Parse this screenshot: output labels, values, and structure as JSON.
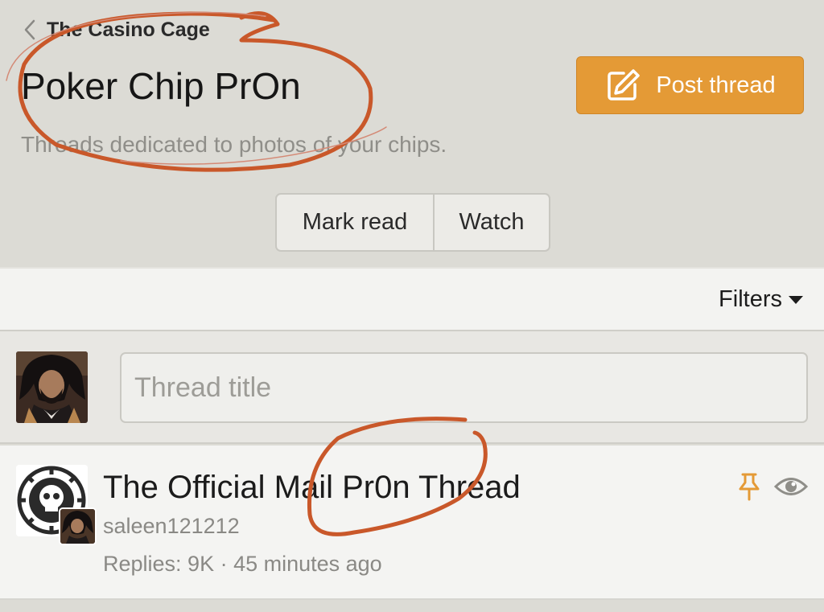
{
  "breadcrumb": {
    "label": "The Casino Cage"
  },
  "forum": {
    "title": "Poker Chip PrOn",
    "description": "Threads dedicated to photos of your chips."
  },
  "actions": {
    "post_thread": "Post thread",
    "mark_read": "Mark read",
    "watch": "Watch"
  },
  "filters": {
    "label": "Filters"
  },
  "new_thread": {
    "placeholder": "Thread title"
  },
  "threads": [
    {
      "title": "The Official Mail Pr0n Thread",
      "author": "saleen121212",
      "meta": "Replies: 9K · 45 minutes ago",
      "pinned": true,
      "watched": true
    }
  ],
  "colors": {
    "accent": "#e49a36",
    "background": "#dcdbd5",
    "annotation": "#c9582a"
  },
  "icons": {
    "back": "chevron-left-icon",
    "post": "edit-icon",
    "filters": "caret-down-icon",
    "pin": "pin-icon",
    "watch": "eye-icon"
  }
}
